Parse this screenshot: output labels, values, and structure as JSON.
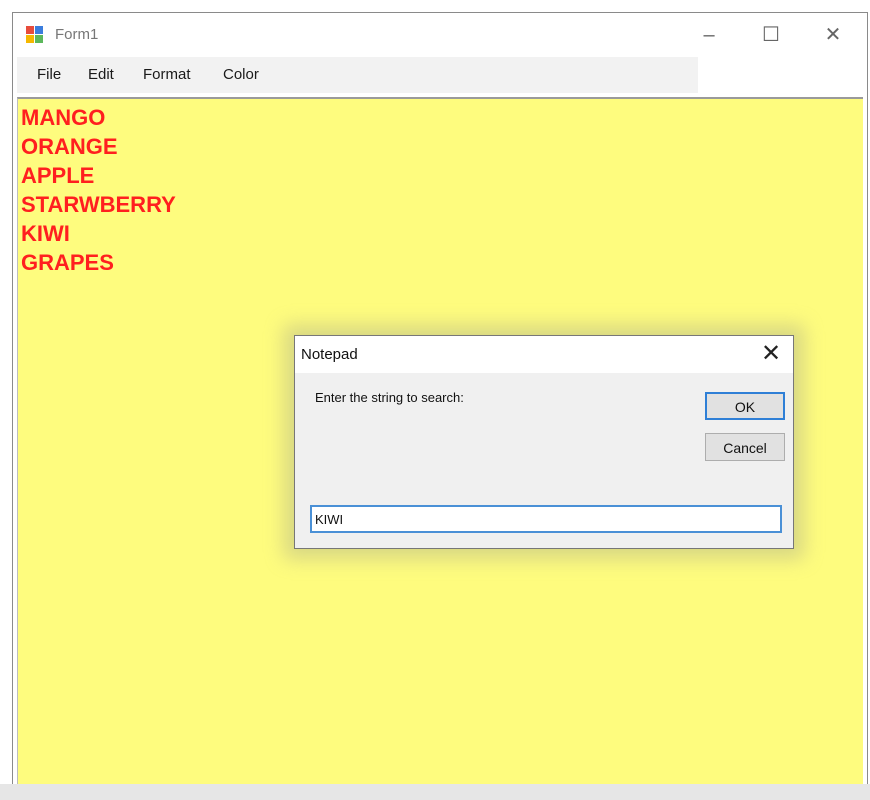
{
  "window": {
    "title": "Form1",
    "controls": {
      "minimize": "–",
      "maximize": "☐",
      "close": "✕"
    }
  },
  "menu": {
    "items": [
      {
        "label": "File"
      },
      {
        "label": "Edit"
      },
      {
        "label": "Format"
      },
      {
        "label": "Color"
      }
    ]
  },
  "editor": {
    "background": "#fefc7e",
    "text_color": "#ff1f1f",
    "lines": [
      "MANGO",
      "ORANGE",
      "APPLE",
      "STARWBERRY",
      "KIWI",
      "GRAPES"
    ]
  },
  "dialog": {
    "title": "Notepad",
    "close_glyph": "✕",
    "prompt": "Enter the string to search:",
    "ok_label": "OK",
    "cancel_label": "Cancel",
    "input_value": "KIWI"
  },
  "icons": {
    "app": "windows-form-icon",
    "dialog_close": "close-icon"
  }
}
